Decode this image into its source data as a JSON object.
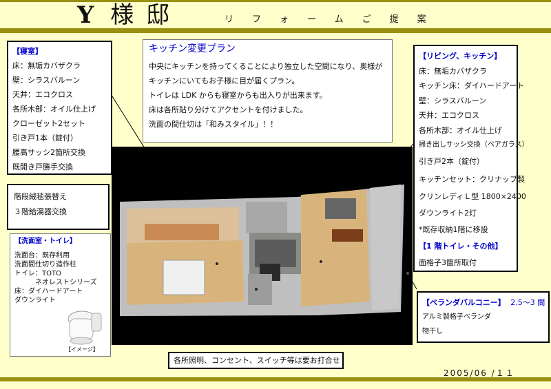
{
  "header": {
    "title_initial": "Y",
    "title_name": "様邸",
    "subtitle": "リフォームご提案"
  },
  "plan": {
    "title": "キッチン変更プラン",
    "lines": [
      "中央にキッチンを持ってくることにより独立した空間になり、奥様が",
      "キッチンにいてもお子様に目が届くプラン。",
      "トイレは LDK からも寝室からも出入りが出来ます。",
      "床は各所貼り分けてアクセントを付けました。",
      "洗面の間仕切は「和みスタイル」！！"
    ]
  },
  "bedroom": {
    "heading": "【寝室】",
    "items": [
      "床：無垢カバザクラ",
      "壁：シラスバルーン",
      "天井：エコクロス",
      "各所木部：オイル仕上げ",
      "クローゼット2セット",
      "引き戸1本（錠付）",
      "腰高サッシ2箇所交換",
      "既開き戸勝手交換"
    ]
  },
  "stairs": {
    "items": [
      "階段絨毯張替え",
      "３階給湯器交換"
    ]
  },
  "washroom": {
    "heading": "【洗面室・トイレ】",
    "items": [
      "洗面台：既存利用",
      "洗面間仕切り造作柱",
      "トイレ：TOTO",
      "　　　ネオレストシリーズ",
      "床：ダイハードアート",
      "ダウンライト"
    ],
    "image_caption": "【イメージ】"
  },
  "living": {
    "heading": "【リビング、キッチン】",
    "items": [
      "床：無垢カバザクラ",
      "キッチン床：ダイハードアート",
      "壁：シラスバルーン",
      "天井：エコクロス",
      "各所木部：オイル仕上げ",
      "掃き出しサッシ交換（ペアガラス）",
      "引き戸2本（錠付）",
      "キッチンセット：クリナップ製",
      "クリンレディＬ型 1800×2400",
      "ダウンライト2灯",
      "*既存収納1階に移設"
    ],
    "toilet_heading": "【1 階トイレ・その他】",
    "toilet_items": [
      "面格子3箇所取付"
    ]
  },
  "veranda": {
    "heading": "【ベランダバルコニー】",
    "size": "2.5～3 間",
    "items": [
      "アルミ製格子ベランダ",
      "物干し"
    ]
  },
  "note": "各所照明、コンセント、スイッチ等は要お打合せ",
  "date": "2005/06 /１１",
  "colors": {
    "background": "#ffffcc",
    "band": "#9a8f10",
    "heading_blue": "#0000cc",
    "floor_wood": "#d8b47c",
    "kitchen_floor": "#8a8a88"
  }
}
